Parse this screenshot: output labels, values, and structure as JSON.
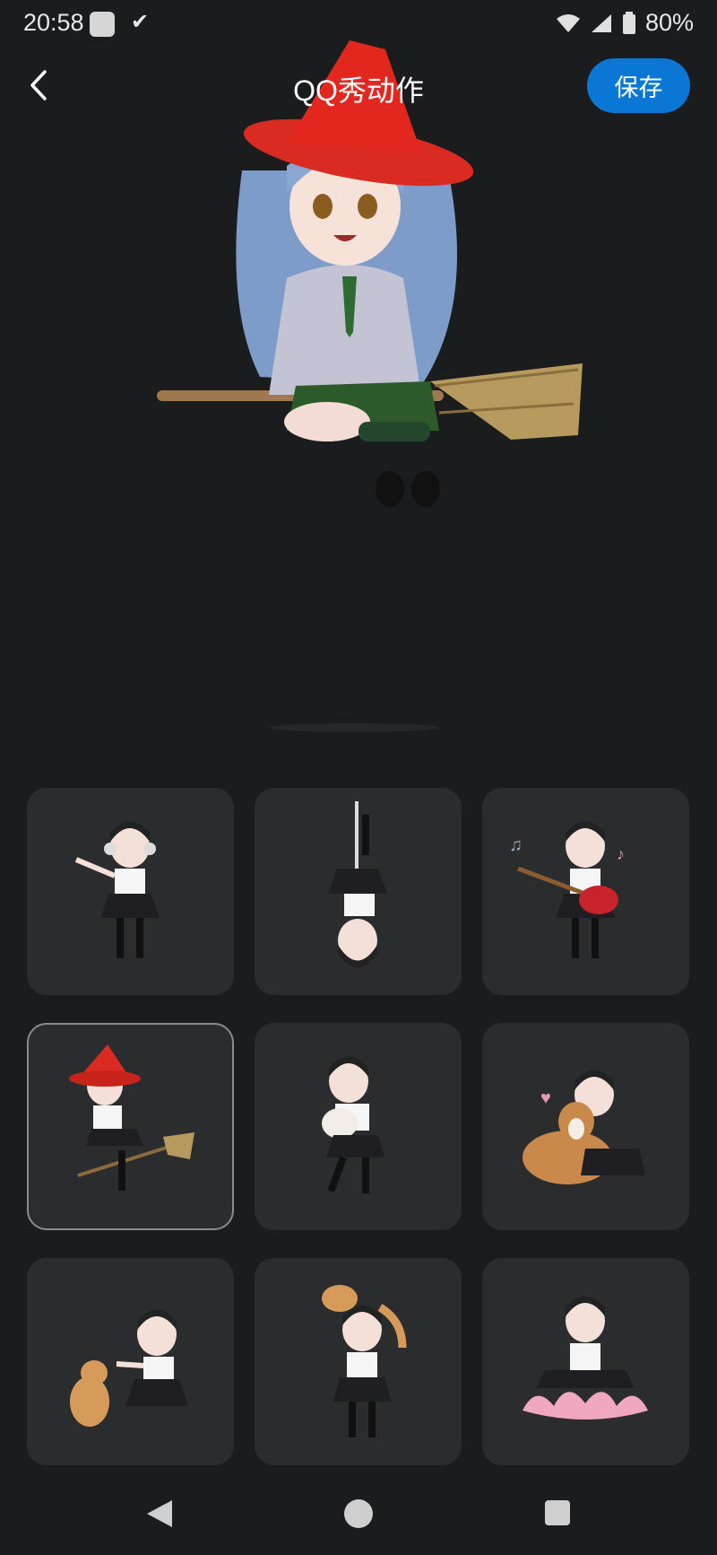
{
  "status_bar": {
    "time": "20:58",
    "battery": "80%"
  },
  "header": {
    "title": "QQ秀动作",
    "save_label": "保存"
  },
  "actions": [
    {
      "name": "dance-headphones"
    },
    {
      "name": "pole-upside-down"
    },
    {
      "name": "guitar"
    },
    {
      "name": "witch-broom",
      "selected": true
    },
    {
      "name": "hold-puppy"
    },
    {
      "name": "hug-dog"
    },
    {
      "name": "high-five-cat"
    },
    {
      "name": "cat-on-shoulder"
    },
    {
      "name": "lotus-meditation"
    }
  ],
  "colors": {
    "background": "#1b1c1e",
    "tile": "#2b2c2e",
    "accent": "#0b77d4"
  }
}
